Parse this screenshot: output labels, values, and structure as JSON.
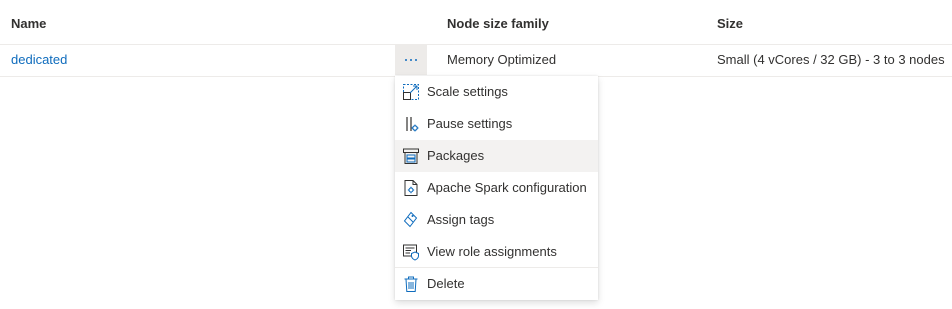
{
  "table": {
    "headers": {
      "name": "Name",
      "node_size_family": "Node size family",
      "size": "Size"
    },
    "rows": [
      {
        "name": "dedicated",
        "node_size_family": "Memory Optimized",
        "size": "Small (4 vCores / 32 GB) - 3 to 3 nodes"
      }
    ],
    "more_button_icon": "more-dots-icon"
  },
  "context_menu": {
    "items": [
      {
        "label": "Scale settings",
        "icon": "scale-icon"
      },
      {
        "label": "Pause settings",
        "icon": "pause-settings-icon"
      },
      {
        "label": "Packages",
        "icon": "packages-icon"
      },
      {
        "label": "Apache Spark configuration",
        "icon": "spark-config-icon"
      },
      {
        "label": "Assign tags",
        "icon": "tag-icon"
      },
      {
        "label": "View role assignments",
        "icon": "role-assignments-icon"
      },
      {
        "label": "Delete",
        "icon": "trash-icon"
      }
    ],
    "hovered_item": "Packages"
  },
  "colors": {
    "accent": "#0f6cbd",
    "text": "#323130",
    "divider": "#edebe9",
    "hover": "#f3f2f1"
  }
}
